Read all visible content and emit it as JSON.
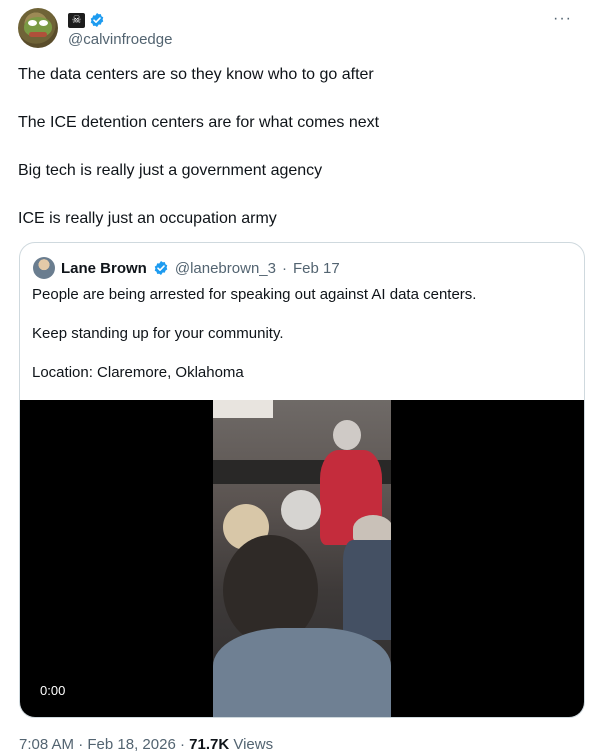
{
  "tweet": {
    "handle": "@calvinfroedge",
    "name_icon": "skull-crossbones",
    "more": "···",
    "lines": [
      "The data centers are so they know who to go after",
      "The ICE detention centers are for what comes next",
      "Big tech is really just a government agency",
      "ICE is really just an occupation army"
    ],
    "time": "7:08 AM",
    "sep1": "·",
    "date": "Feb 18, 2026",
    "sep2": "·",
    "views_count": "71.7K",
    "views_label": "Views"
  },
  "quote": {
    "name": "Lane Brown",
    "handle": "@lanebrown_3",
    "sep": "·",
    "date": "Feb 17",
    "lines": [
      "People are being arrested for speaking out against AI data centers.",
      "Keep standing up for your community.",
      "Location: Claremore, Oklahoma"
    ],
    "video_time": "0:00"
  },
  "colors": {
    "verified": "#1d9bf0",
    "secondary": "#536471",
    "primary": "#0f1419"
  }
}
